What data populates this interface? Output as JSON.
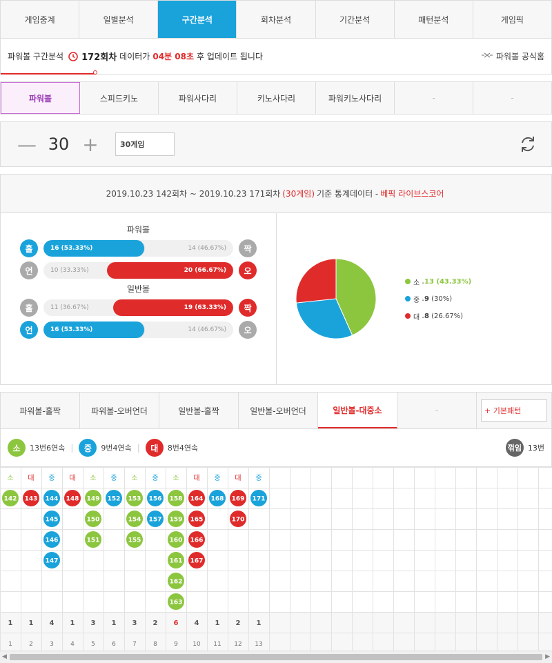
{
  "top_tabs": [
    "게임중계",
    "일별분석",
    "구간분석",
    "회차분석",
    "기간분석",
    "패턴분석",
    "게임픽"
  ],
  "info": {
    "prefix": "파워볼 구간분석",
    "round": "172회차",
    "mid": "데이터가",
    "time": "04분 08초",
    "suffix": "후 업데이트 됩니다",
    "official": "파워볼 공식홈"
  },
  "game_tabs": [
    "파워볼",
    "스피드키노",
    "파워사다리",
    "키노사다리",
    "파워키노사다리",
    "-",
    "-"
  ],
  "counter": {
    "value": "30",
    "games": "30게임",
    "minus": "—",
    "plus": "+"
  },
  "stats": {
    "range": "2019.10.23 142회차 ~ 2019.10.23 171회차",
    "games": "(30게임)",
    "label": "기준 통계데이터 -",
    "brand": "베픽 라이브스코어",
    "powerball_title": "파워볼",
    "normal_title": "일반볼",
    "rows": [
      {
        "l": "홀",
        "r": "짝",
        "lt": "16 (53.33%)",
        "rt": "14 (46.67%)",
        "side": "left",
        "pct": 53.33,
        "color": "#1aa3db",
        "lball": "b-blue",
        "rball": "b-gray"
      },
      {
        "l": "언",
        "r": "오",
        "lt": "10 (33.33%)",
        "rt": "20 (66.67%)",
        "side": "right",
        "pct": 66.67,
        "color": "#e02b2b",
        "lball": "b-gray",
        "rball": "b-red"
      },
      {
        "l": "홀",
        "r": "짝",
        "lt": "11 (36.67%)",
        "rt": "19 (63.33%)",
        "side": "right",
        "pct": 63.33,
        "color": "#e02b2b",
        "lball": "b-gray",
        "rball": "b-red"
      },
      {
        "l": "언",
        "r": "오",
        "lt": "16 (53.33%)",
        "rt": "14 (46.67%)",
        "side": "left",
        "pct": 53.33,
        "color": "#1aa3db",
        "lball": "b-blue",
        "rball": "b-gray"
      }
    ],
    "pie": [
      {
        "label": "소",
        "count": "13",
        "pct": "(43.33%)",
        "value": 13,
        "color": "#8cc63f"
      },
      {
        "label": "중",
        "count": "9",
        "pct": "(30%)",
        "value": 9,
        "color": "#1aa3db"
      },
      {
        "label": "대",
        "count": "8",
        "pct": "(26.67%)",
        "value": 8,
        "color": "#e02b2b"
      }
    ]
  },
  "pattern_tabs": [
    "파워볼-홀짝",
    "파워볼-오버언더",
    "일반볼-홀짝",
    "일반볼-오버언더",
    "일반볼-대중소",
    "-"
  ],
  "add_button": "+ 기본패턴",
  "summary": {
    "items": [
      {
        "ball": "소",
        "text": "13번6연속",
        "cls": "b-green"
      },
      {
        "ball": "중",
        "text": "9번4연속",
        "cls": "b-blue"
      },
      {
        "ball": "대",
        "text": "8번4연속",
        "cls": "b-red"
      }
    ],
    "turn_label": "꺾임",
    "turn_count": "13번"
  },
  "grid": {
    "columns": [
      {
        "head": "소",
        "cls": "g",
        "balls": [
          "142"
        ]
      },
      {
        "head": "대",
        "cls": "r",
        "balls": [
          "143"
        ]
      },
      {
        "head": "중",
        "cls": "b",
        "balls": [
          "144",
          "145",
          "146",
          "147"
        ]
      },
      {
        "head": "대",
        "cls": "r",
        "balls": [
          "148"
        ]
      },
      {
        "head": "소",
        "cls": "g",
        "balls": [
          "149",
          "150",
          "151"
        ]
      },
      {
        "head": "중",
        "cls": "b",
        "balls": [
          "152"
        ]
      },
      {
        "head": "소",
        "cls": "g",
        "balls": [
          "153",
          "154",
          "155"
        ]
      },
      {
        "head": "중",
        "cls": "b",
        "balls": [
          "156",
          "157"
        ]
      },
      {
        "head": "소",
        "cls": "g",
        "balls": [
          "158",
          "159",
          "160",
          "161",
          "162",
          "163"
        ]
      },
      {
        "head": "대",
        "cls": "r",
        "balls": [
          "164",
          "165",
          "166",
          "167"
        ]
      },
      {
        "head": "중",
        "cls": "b",
        "balls": [
          "168"
        ]
      },
      {
        "head": "대",
        "cls": "r",
        "balls": [
          "169",
          "170"
        ]
      },
      {
        "head": "중",
        "cls": "b",
        "balls": [
          "171"
        ]
      }
    ],
    "counts": [
      "1",
      "1",
      "4",
      "1",
      "3",
      "1",
      "3",
      "2",
      "6",
      "4",
      "1",
      "2",
      "1"
    ],
    "index": [
      "1",
      "2",
      "3",
      "4",
      "5",
      "6",
      "7",
      "8",
      "9",
      "10",
      "11",
      "12",
      "13"
    ],
    "highlight_index": 8,
    "colors": {
      "g": "#8cc63f",
      "r": "#e02b2b",
      "b": "#1aa3db"
    }
  }
}
